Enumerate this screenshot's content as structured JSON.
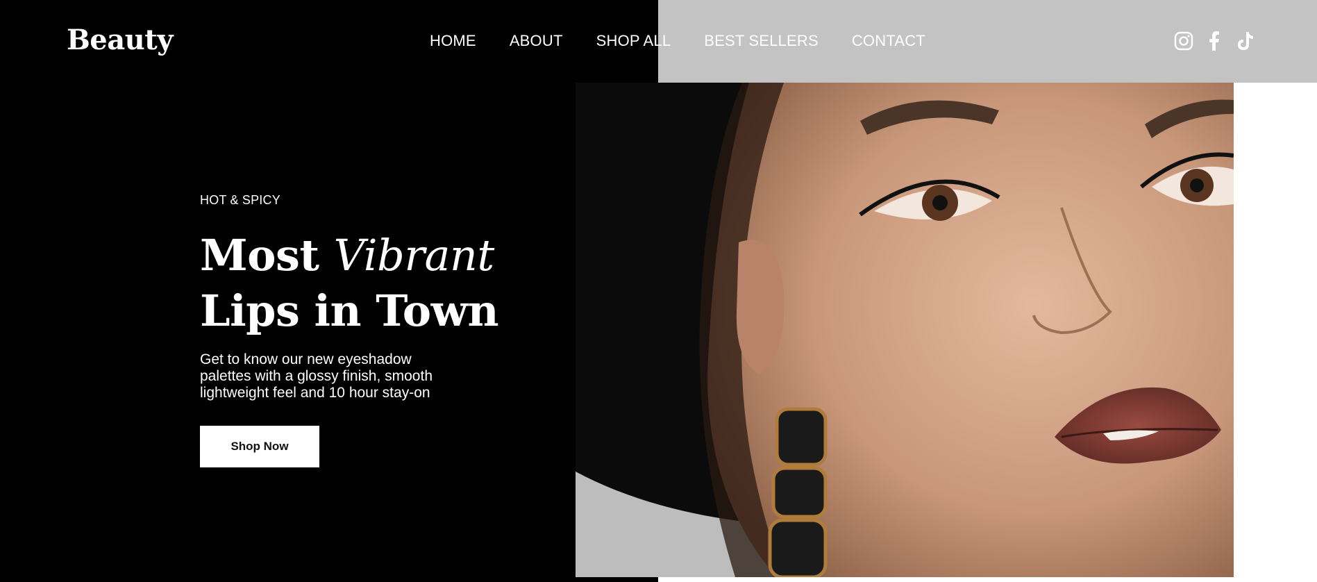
{
  "header": {
    "logo": "Beauty",
    "nav": [
      {
        "label": "HOME"
      },
      {
        "label": "ABOUT"
      },
      {
        "label": "SHOP ALL"
      },
      {
        "label": "BEST SELLERS"
      },
      {
        "label": "CONTACT"
      }
    ],
    "social": [
      {
        "icon": "instagram-icon"
      },
      {
        "icon": "facebook-icon"
      },
      {
        "icon": "tiktok-icon"
      }
    ]
  },
  "hero": {
    "eyebrow": "HOT & SPICY",
    "headline_part1": "Most ",
    "headline_italic": "Vibrant",
    "headline_line2": "Lips in Town",
    "description": "Get to know our new eyeshadow palettes with a glossy finish, smooth lightweight feel and 10 hour stay-on",
    "cta_label": "Shop Now"
  },
  "colors": {
    "background_dark": "#000000",
    "header_gray": "#c3c3c3",
    "text_light": "#ffffff",
    "button_bg": "#ffffff",
    "lip_color": "#7a3a33"
  }
}
